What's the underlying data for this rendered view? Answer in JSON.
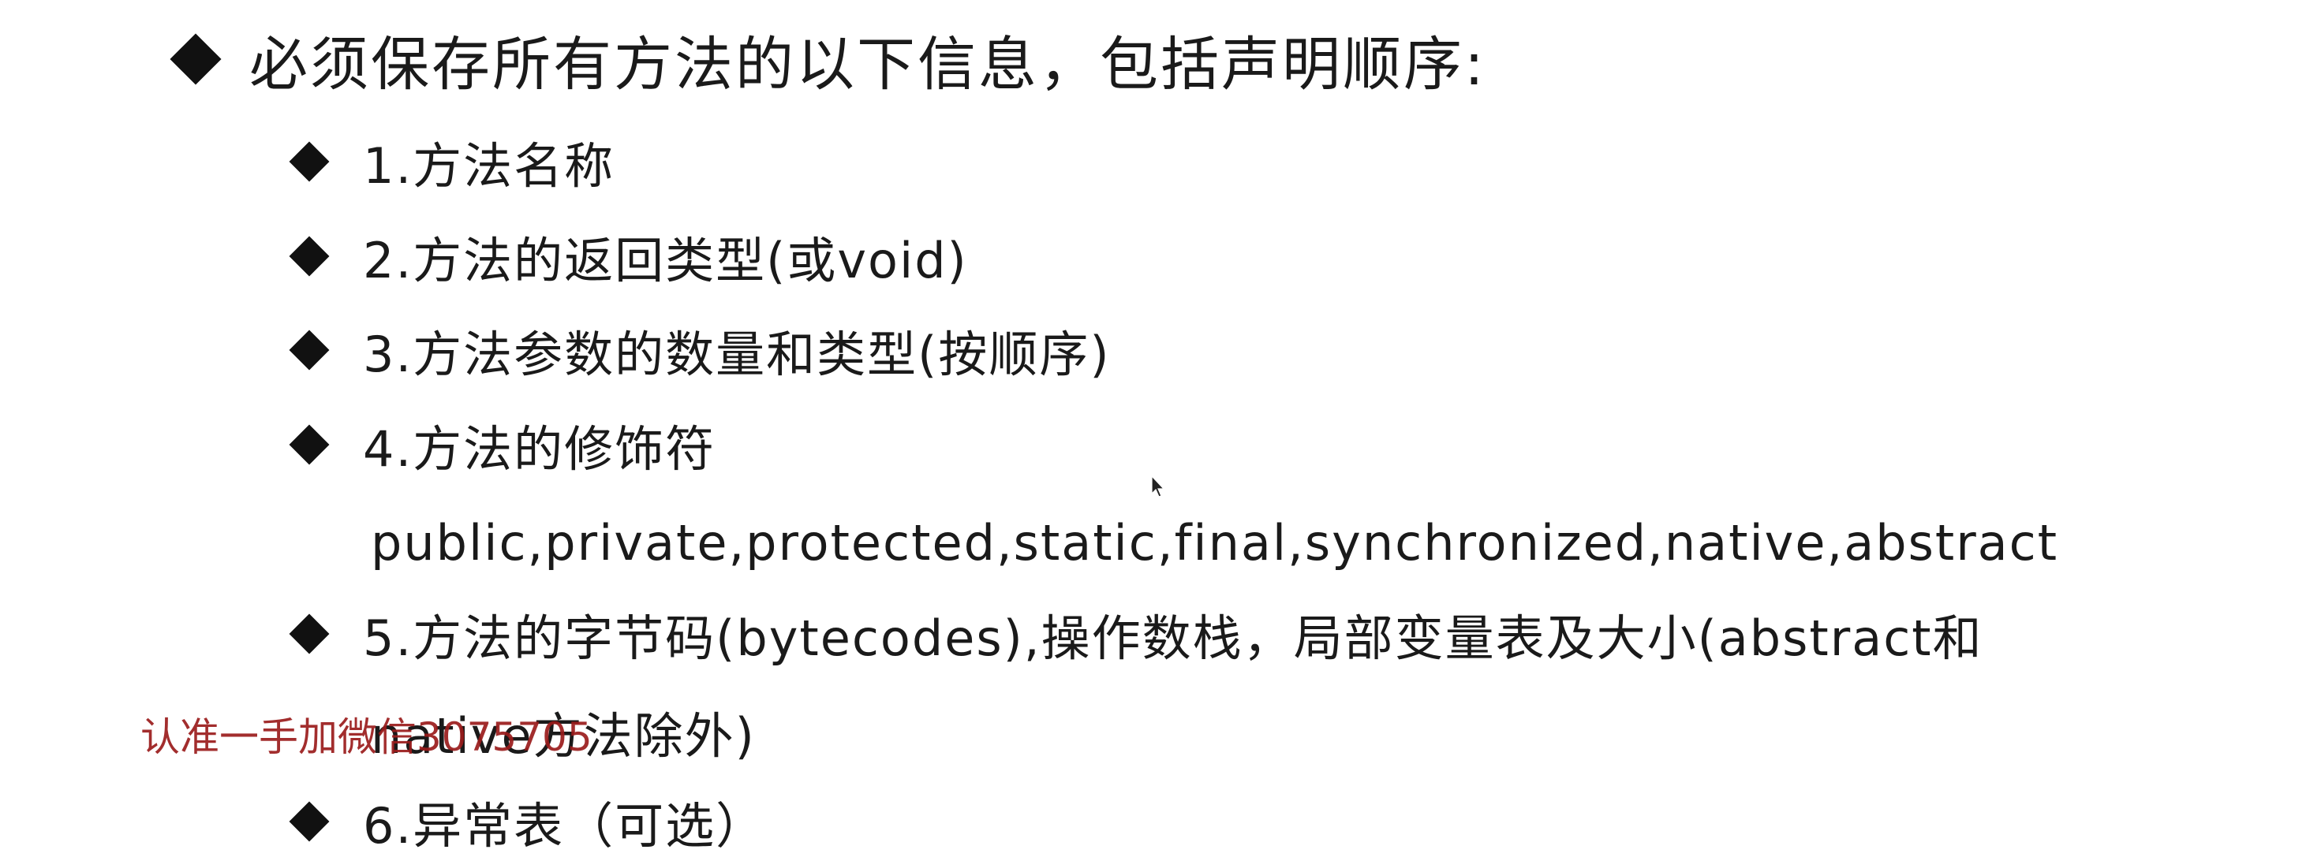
{
  "slide": {
    "heading": "必须保存所有方法的以下信息，包括声明顺序:",
    "items": [
      {
        "text": "1.方法名称"
      },
      {
        "text": "2.方法的返回类型(或void)"
      },
      {
        "text": "3.方法参数的数量和类型(按顺序)"
      },
      {
        "text": "4.方法的修饰符",
        "continuation": "public,private,protected,static,final,synchronized,native,abstract"
      },
      {
        "text": "5.方法的字节码(bytecodes),操作数栈，局部变量表及大小(abstract和",
        "continuation": "native方法除外)"
      },
      {
        "text": "6.异常表（可选）"
      }
    ],
    "watermark": "认准一手加微信3075705",
    "bullet_icon": "diamond-bullet-icon"
  },
  "colors": {
    "text": "#1a1a1a",
    "bullet": "#111111",
    "watermark": "#9b1c1c",
    "background": "#ffffff"
  }
}
